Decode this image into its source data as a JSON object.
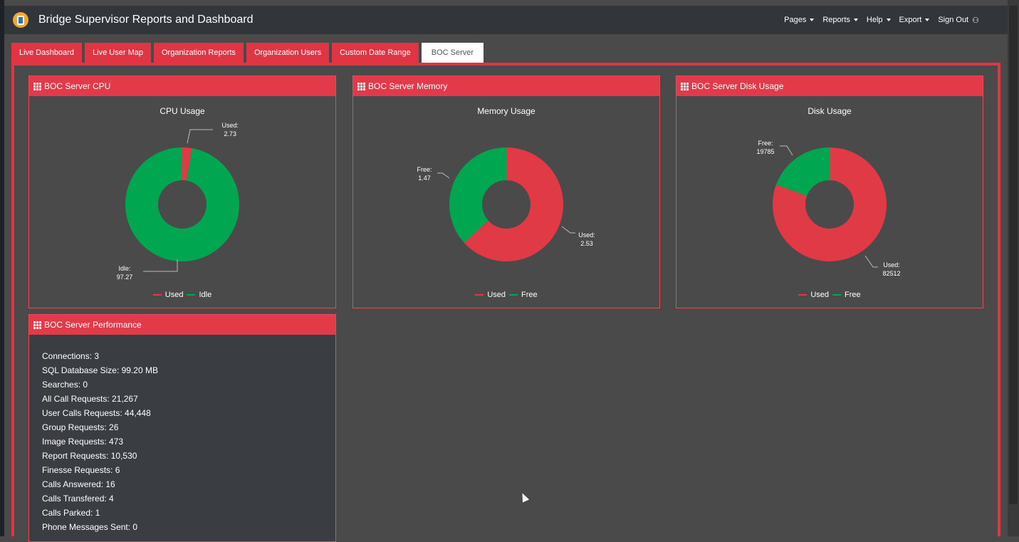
{
  "app": {
    "title": "Bridge Supervisor Reports and Dashboard"
  },
  "nav": {
    "items": [
      {
        "label": "Pages"
      },
      {
        "label": "Reports"
      },
      {
        "label": "Help"
      },
      {
        "label": "Export"
      }
    ],
    "signout": "Sign Out",
    "signout_icon": "user-icon"
  },
  "tabs": [
    {
      "label": "Live Dashboard",
      "active": false
    },
    {
      "label": "Live User Map",
      "active": false
    },
    {
      "label": "Organization Reports",
      "active": false
    },
    {
      "label": "Organization Users",
      "active": false
    },
    {
      "label": "Custom Date Range",
      "active": false
    },
    {
      "label": "BOC Server",
      "active": true
    }
  ],
  "colors": {
    "accent": "#e23a48",
    "used": "#e03a47",
    "free": "#00a650"
  },
  "panels": {
    "cpu": {
      "header": "BOC Server CPU",
      "chart_title": "CPU Usage",
      "legend": [
        "Used",
        "Idle"
      ],
      "used_label": "Used:",
      "used_value": "2.73",
      "idle_label": "Idle:",
      "idle_value": "97.27"
    },
    "memory": {
      "header": "BOC Server Memory",
      "chart_title": "Memory Usage",
      "legend": [
        "Used",
        "Free"
      ],
      "free_label": "Free:",
      "free_value": "1.47",
      "used_label": "Used:",
      "used_value": "2.53"
    },
    "disk": {
      "header": "BOC Server Disk Usage",
      "chart_title": "Disk Usage",
      "legend": [
        "Used",
        "Free"
      ],
      "free_label": "Free:",
      "free_value": "19785",
      "used_label": "Used:",
      "used_value": "82512"
    },
    "performance": {
      "header": "BOC Server Performance",
      "stats": [
        "Connections: 3",
        "SQL Database Size: 99.20 MB",
        "Searches: 0",
        "All Call Requests: 21,267",
        "User Calls Requests: 44,448",
        "Group Requests: 26",
        "Image Requests: 473",
        "Report Requests: 10,530",
        "Finesse Requests: 6",
        "Calls Answered: 16",
        "Calls Transfered: 4",
        "Calls Parked: 1",
        "Phone Messages Sent: 0"
      ]
    }
  },
  "chart_data": [
    {
      "type": "pie",
      "title": "CPU Usage",
      "categories": [
        "Used",
        "Idle"
      ],
      "values": [
        2.73,
        97.27
      ]
    },
    {
      "type": "pie",
      "title": "Memory Usage",
      "categories": [
        "Used",
        "Free"
      ],
      "values": [
        2.53,
        1.47
      ]
    },
    {
      "type": "pie",
      "title": "Disk Usage",
      "categories": [
        "Used",
        "Free"
      ],
      "values": [
        82512,
        19785
      ]
    }
  ]
}
